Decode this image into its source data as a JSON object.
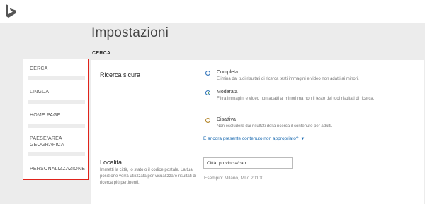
{
  "header": {
    "logo": "bing-logo-icon"
  },
  "page": {
    "title": "Impostazioni",
    "section": "CERCA"
  },
  "sidebar": {
    "items": [
      {
        "label": "CERCA"
      },
      {
        "label": "LINGUA"
      },
      {
        "label": "HOME PAGE"
      },
      {
        "label_line1": "PAESE/AREA",
        "label_line2": "GEOGRAFICA"
      },
      {
        "label": "PERSONALIZZAZIONE"
      }
    ]
  },
  "safe_search": {
    "title": "Ricerca sicura",
    "options": [
      {
        "label": "Completa",
        "desc": "Elimina dai tuoi risultati di ricerca testi immagini e video non adatti ai minori.",
        "selected": false
      },
      {
        "label": "Moderata",
        "desc": "Filtra immagini e video non adatti ai minori ma non il testo dei tuoi risultati di ricerca.",
        "selected": true
      },
      {
        "label": "Disattiva",
        "desc": "Non escludere dai risultati della ricerca il contenuto per adulti.",
        "selected": false
      }
    ],
    "report_link": "È ancora presente contenuto non appropriato?"
  },
  "location": {
    "title": "Località",
    "desc": "Immetti la città, lo stato o il codice postale. La tua posizione verrà utilizzata per visualizzare risultati di ricerca più pertinenti.",
    "input_value": "Città, provincia/cap",
    "example": "Esempio: Milano, MI o 20100"
  },
  "colors": {
    "accent": "#1a6ab0",
    "sidebar_border": "#e0231b",
    "selected_radio": "#2d8a2d"
  }
}
